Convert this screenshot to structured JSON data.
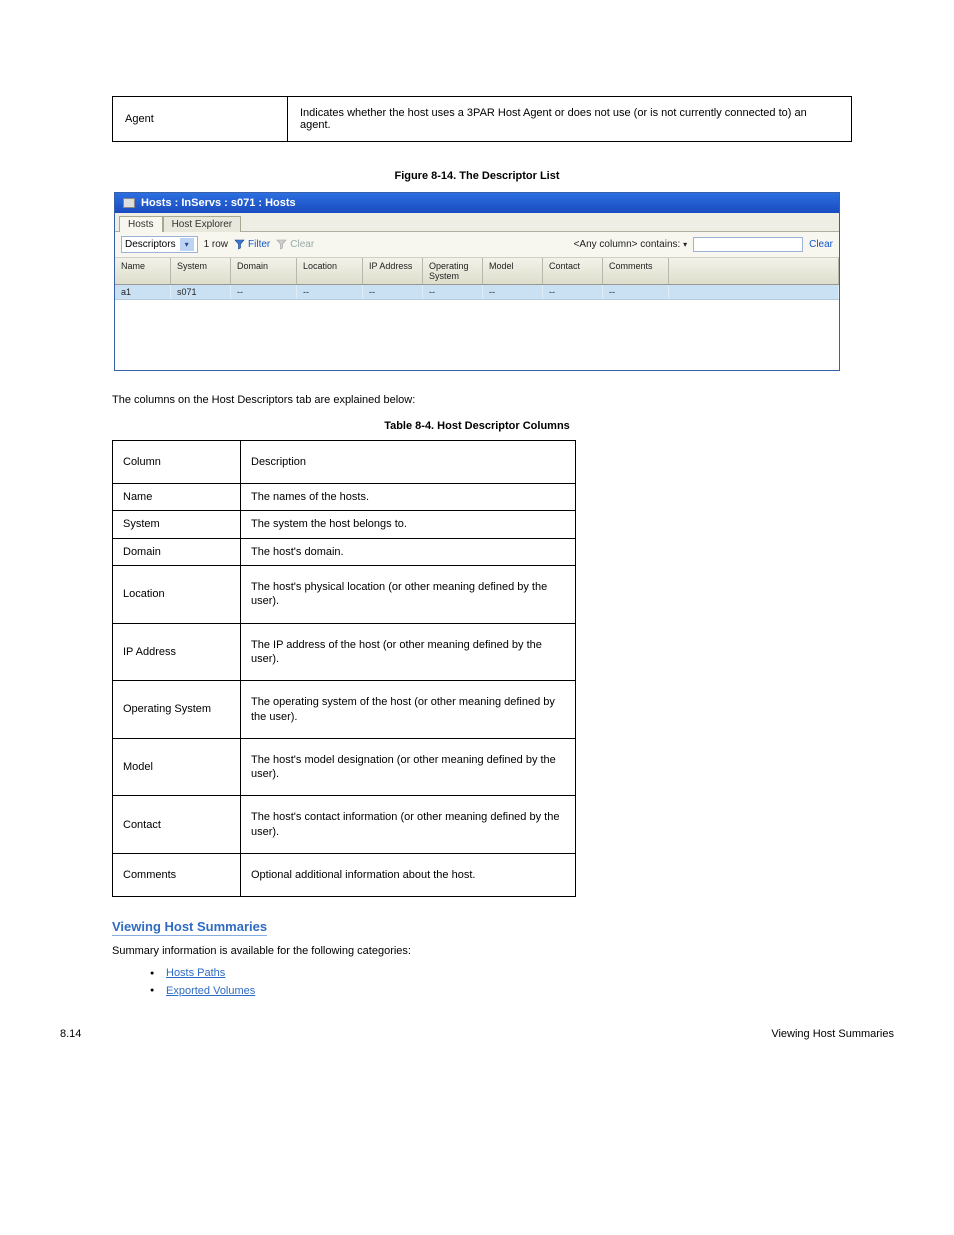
{
  "top_table": {
    "col_label": "Agent",
    "col_desc": "Indicates whether the host uses a 3PAR Host Agent or does not use (or is not currently connected to) an agent."
  },
  "figure_caption": "Figure 8-14.  The Descriptor List",
  "window": {
    "title": "Hosts : InServs : s071 : Hosts",
    "tabs": [
      "Hosts",
      "Host Explorer"
    ],
    "active_tab_index": 0,
    "viewSelector": "Descriptors",
    "rowCount": "1 row",
    "filterLabel": "Filter",
    "clearFilterLabel": "Clear",
    "searchScope": "<Any column> contains:",
    "clearSearchLabel": "Clear",
    "columns": [
      "Name",
      "System",
      "Domain",
      "Location",
      "IP Address",
      "Operating System",
      "Model",
      "Contact",
      "Comments"
    ],
    "rows": [
      {
        "Name": "a1",
        "System": "s071",
        "Domain": "--",
        "Location": "--",
        "IP Address": "--",
        "Operating System": "--",
        "Model": "--",
        "Contact": "--",
        "Comments": "--"
      }
    ]
  },
  "body_para": "The columns on the Host Descriptors tab are explained below:",
  "desc_table_caption": "Table 8-4.  Host Descriptor Columns",
  "desc_table": {
    "headers": [
      "Column",
      "Description"
    ],
    "rows": [
      [
        "Name",
        "The names of the hosts."
      ],
      [
        "System",
        "The system the host belongs to."
      ],
      [
        "Domain",
        "The host's domain."
      ],
      [
        "Location",
        "The host's physical location (or other meaning defined by the user)."
      ],
      [
        "IP Address",
        "The IP address of the host (or other meaning defined by the user)."
      ],
      [
        "Operating System",
        "The operating system of the host (or other meaning defined by the user)."
      ],
      [
        "Model",
        "The host's model designation (or other meaning defined by the user)."
      ],
      [
        "Contact",
        "The host's contact information (or other meaning defined by the user)."
      ],
      [
        "Comments",
        "Optional additional information about the host."
      ]
    ]
  },
  "section_heading": "Viewing Host Summaries",
  "section_para": "Summary information is available for the following categories:",
  "bullets": [
    {
      "text": "Hosts Paths",
      "href": "#"
    },
    {
      "text": "Exported Volumes",
      "href": "#"
    }
  ],
  "footer": {
    "page": "8.14",
    "right": "Viewing Host Summaries"
  }
}
